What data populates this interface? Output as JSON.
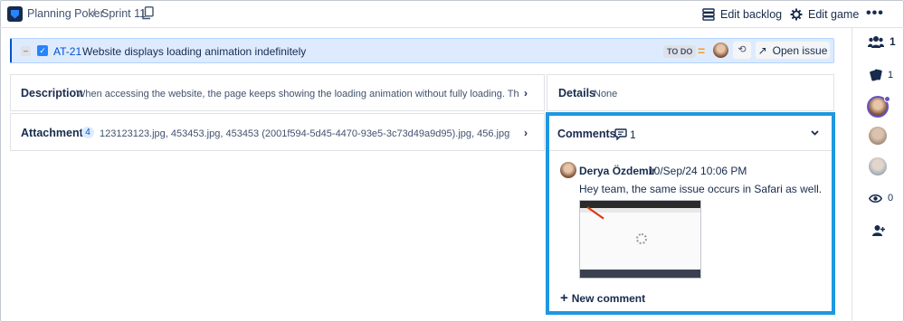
{
  "app": {
    "name": "Planning Poker",
    "separator": "/",
    "sprint": "Sprint 11"
  },
  "toolbar": {
    "edit_backlog": "Edit backlog",
    "edit_game": "Edit game",
    "more": "•••"
  },
  "issue": {
    "collapse": "–",
    "key": "AT-21",
    "title": "Website displays loading animation indefinitely",
    "status": "TO DO",
    "priority_symbol": "=",
    "open_label": "Open issue",
    "open_icon": "↗"
  },
  "description": {
    "label": "Description",
    "text": "When accessing the website, the page keeps showing the loading animation without fully loading. This bug occurs on ..."
  },
  "details": {
    "label": "Details",
    "value": "None"
  },
  "attachments": {
    "label": "Attachments",
    "count": "4",
    "files": "123123123.jpg, 453453.jpg, 453453 (2001f594-5d45-4470-93e5-3c73d49a9d95).jpg, 456.jpg"
  },
  "comments": {
    "label": "Comments",
    "count": "1",
    "items": [
      {
        "author": "Derya Özdemir",
        "date": "10/Sep/24 10:06 PM",
        "body": "Hey team, the same issue occurs in Safari as well."
      }
    ],
    "new_comment": "New comment"
  },
  "sidebar": {
    "participants": "1",
    "cards": "1",
    "observers": "0"
  },
  "icons": [
    "copy-icon",
    "backlog-icon",
    "gear-icon",
    "users-icon",
    "cards-icon",
    "eye-icon",
    "add-user-icon",
    "comment-icon",
    "chevron-right-icon",
    "chevron-down-icon",
    "plus-icon",
    "sync-icon"
  ]
}
